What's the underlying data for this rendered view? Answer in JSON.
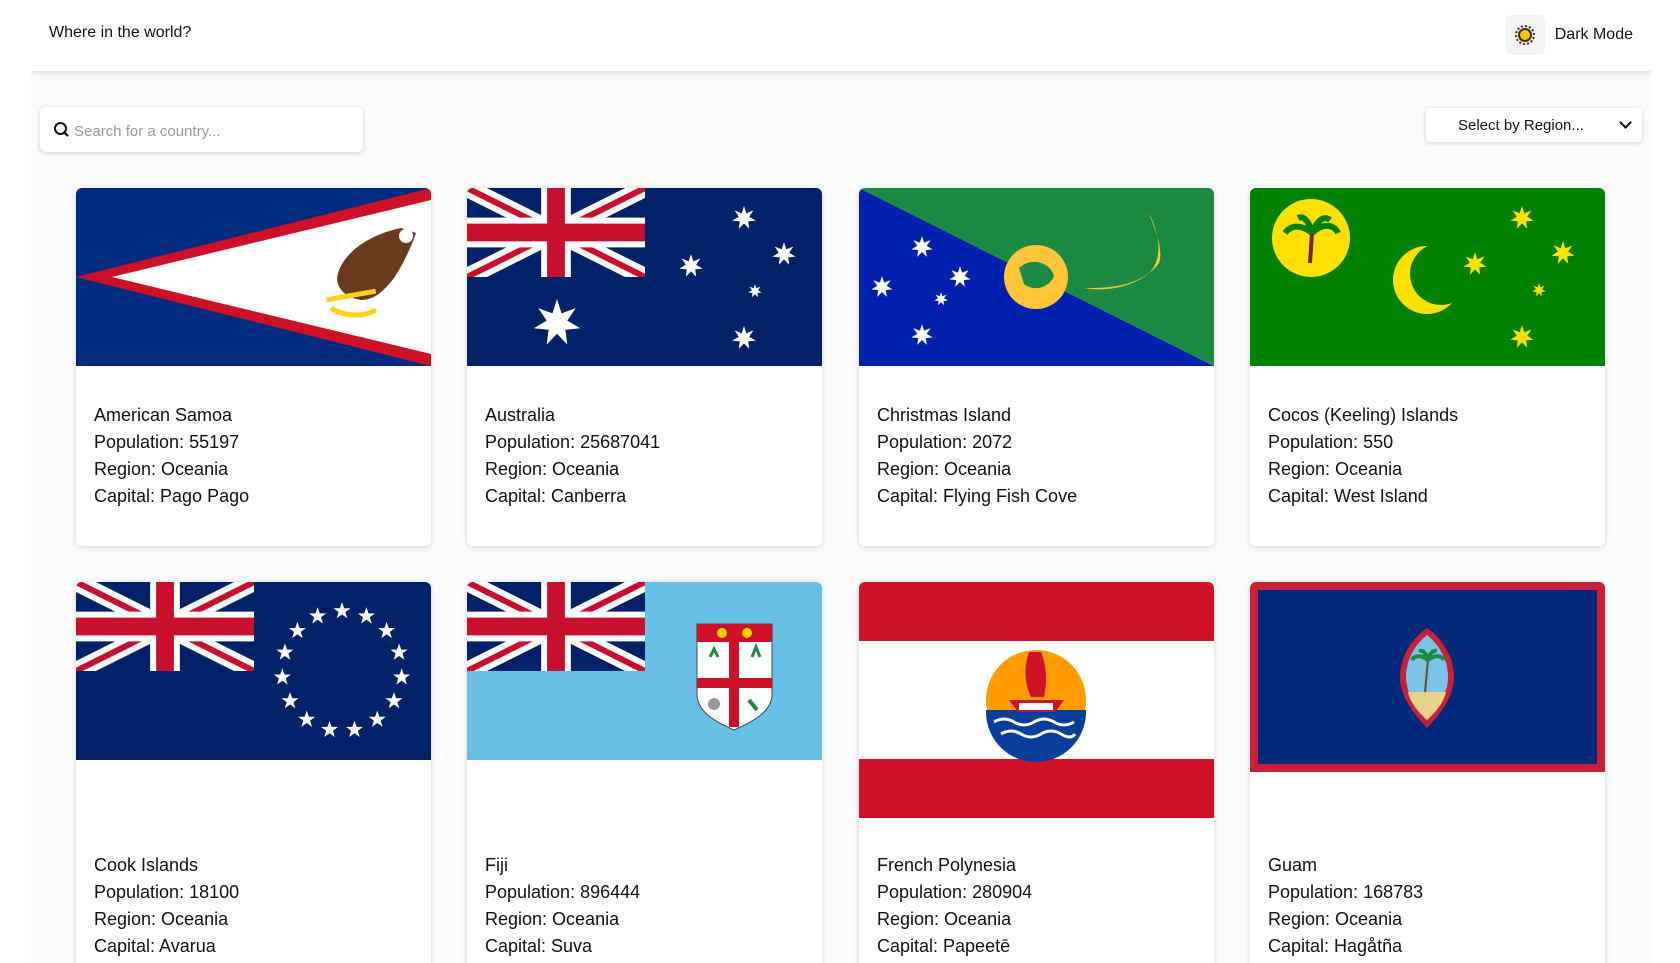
{
  "header": {
    "title": "Where in the world?",
    "mode_label": "Dark Mode"
  },
  "search": {
    "placeholder": "Search for a country..."
  },
  "filter": {
    "label": "Select by Region..."
  },
  "countries": [
    {
      "name": "American Samoa",
      "population": "Population: 55197",
      "region": "Region: Oceania",
      "capital": "Capital: Pago Pago",
      "flag": "american-samoa-flag"
    },
    {
      "name": "Australia",
      "population": "Population: 25687041",
      "region": "Region: Oceania",
      "capital": "Capital: Canberra",
      "flag": "australia-flag"
    },
    {
      "name": "Christmas Island",
      "population": "Population: 2072",
      "region": "Region: Oceania",
      "capital": "Capital: Flying Fish Cove",
      "flag": "christmas-island-flag"
    },
    {
      "name": "Cocos (Keeling) Islands",
      "population": "Population: 550",
      "region": "Region: Oceania",
      "capital": "Capital: West Island",
      "flag": "cocos-islands-flag"
    },
    {
      "name": "Cook Islands",
      "population": "Population: 18100",
      "region": "Region: Oceania",
      "capital": "Capital: Avarua",
      "flag": "cook-islands-flag"
    },
    {
      "name": "Fiji",
      "population": "Population: 896444",
      "region": "Region: Oceania",
      "capital": "Capital: Suva",
      "flag": "fiji-flag"
    },
    {
      "name": "French Polynesia",
      "population": "Population: 280904",
      "region": "Region: Oceania",
      "capital": "Capital: Papeetē",
      "flag": "french-polynesia-flag"
    },
    {
      "name": "Guam",
      "population": "Population: 168783",
      "region": "Region: Oceania",
      "capital": "Capital: Hagåtña",
      "flag": "guam-flag"
    }
  ]
}
